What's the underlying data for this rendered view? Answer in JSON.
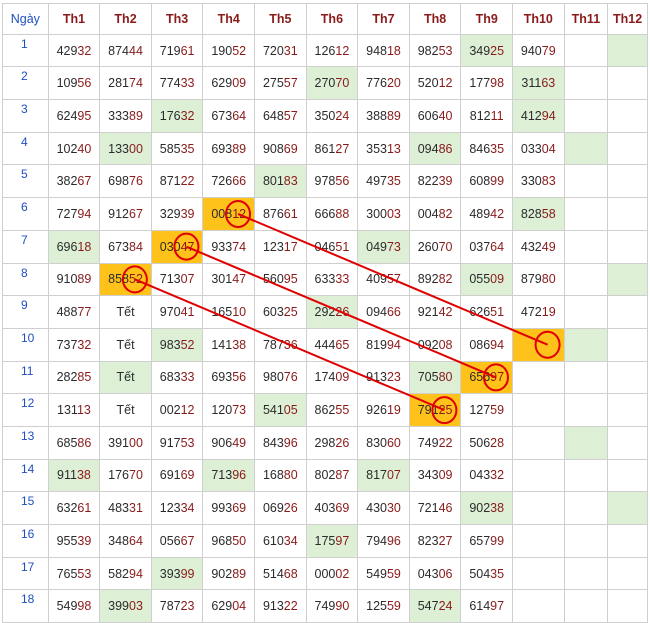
{
  "header": {
    "day_label": "Ngày",
    "months": [
      "Th1",
      "Th2",
      "Th3",
      "Th4",
      "Th5",
      "Th6",
      "Th7",
      "Th8",
      "Th9",
      "Th10",
      "Th11",
      "Th12"
    ]
  },
  "rows": [
    {
      "day": "1",
      "cells": [
        "42932",
        "87444",
        "71961",
        "19052",
        "72031",
        "12612",
        "94818",
        "98253",
        "34925",
        "94079",
        "",
        ""
      ]
    },
    {
      "day": "2",
      "cells": [
        "10956",
        "28174",
        "77433",
        "62909",
        "27557",
        "27070",
        "77620",
        "52012",
        "17798",
        "31163",
        "",
        ""
      ]
    },
    {
      "day": "3",
      "cells": [
        "62495",
        "33389",
        "17632",
        "67364",
        "64857",
        "35024",
        "38889",
        "60640",
        "81211",
        "41294",
        "",
        ""
      ]
    },
    {
      "day": "4",
      "cells": [
        "10240",
        "13300",
        "58535",
        "69389",
        "90869",
        "86127",
        "35313",
        "09486",
        "84635",
        "03304",
        "",
        ""
      ]
    },
    {
      "day": "5",
      "cells": [
        "38267",
        "69876",
        "87122",
        "72666",
        "80183",
        "97856",
        "49735",
        "82239",
        "60899",
        "33083",
        "",
        ""
      ]
    },
    {
      "day": "6",
      "cells": [
        "72794",
        "91267",
        "32939",
        "00812",
        "87661",
        "66688",
        "30003",
        "00482",
        "48942",
        "82858",
        "",
        ""
      ]
    },
    {
      "day": "7",
      "cells": [
        "69618",
        "67384",
        "03047",
        "93374",
        "12317",
        "04651",
        "04973",
        "26070",
        "03764",
        "43249",
        "",
        ""
      ]
    },
    {
      "day": "8",
      "cells": [
        "91089",
        "85852",
        "71307",
        "30147",
        "56095",
        "63333",
        "40957",
        "89282",
        "05509",
        "87980",
        "",
        ""
      ]
    },
    {
      "day": "9",
      "cells": [
        "48877",
        "Tết",
        "97041",
        "16510",
        "60325",
        "29226",
        "09466",
        "92142",
        "62651",
        "47219",
        "",
        ""
      ]
    },
    {
      "day": "10",
      "cells": [
        "73732",
        "Tết",
        "98352",
        "14138",
        "78736",
        "44465",
        "81994",
        "09208",
        "08694",
        "",
        "",
        ""
      ]
    },
    {
      "day": "11",
      "cells": [
        "28285",
        "Tết",
        "68333",
        "69356",
        "98076",
        "17409",
        "91323",
        "70580",
        "65697",
        "",
        "",
        ""
      ]
    },
    {
      "day": "12",
      "cells": [
        "13113",
        "Tết",
        "00212",
        "12073",
        "54105",
        "86255",
        "92619",
        "79125",
        "12759",
        "",
        "",
        ""
      ]
    },
    {
      "day": "13",
      "cells": [
        "68586",
        "39100",
        "91753",
        "90649",
        "84396",
        "29826",
        "83060",
        "74922",
        "50628",
        "",
        "",
        ""
      ]
    },
    {
      "day": "14",
      "cells": [
        "91138",
        "17670",
        "69169",
        "71396",
        "16880",
        "80287",
        "81707",
        "34309",
        "04332",
        "",
        "",
        ""
      ]
    },
    {
      "day": "15",
      "cells": [
        "63261",
        "48331",
        "12334",
        "99369",
        "06926",
        "40369",
        "43030",
        "72146",
        "90238",
        "",
        "",
        ""
      ]
    },
    {
      "day": "16",
      "cells": [
        "95539",
        "34864",
        "05667",
        "96850",
        "61034",
        "17597",
        "79496",
        "82327",
        "65799",
        "",
        "",
        ""
      ]
    },
    {
      "day": "17",
      "cells": [
        "76553",
        "58294",
        "39399",
        "90289",
        "51468",
        "00002",
        "54959",
        "04306",
        "50435",
        "",
        "",
        ""
      ]
    },
    {
      "day": "18",
      "cells": [
        "54998",
        "39903",
        "78723",
        "62904",
        "91322",
        "74990",
        "12559",
        "54724",
        "61497",
        "",
        "",
        ""
      ]
    }
  ],
  "green_cells": [
    [
      0,
      8
    ],
    [
      0,
      11
    ],
    [
      1,
      5
    ],
    [
      1,
      9
    ],
    [
      2,
      2
    ],
    [
      2,
      9
    ],
    [
      3,
      1
    ],
    [
      3,
      7
    ],
    [
      3,
      10
    ],
    [
      4,
      4
    ],
    [
      5,
      9
    ],
    [
      6,
      0
    ],
    [
      6,
      6
    ],
    [
      7,
      1
    ],
    [
      7,
      8
    ],
    [
      7,
      11
    ],
    [
      8,
      5
    ],
    [
      9,
      2
    ],
    [
      9,
      10
    ],
    [
      10,
      1
    ],
    [
      10,
      7
    ],
    [
      11,
      4
    ],
    [
      12,
      10
    ],
    [
      13,
      0
    ],
    [
      13,
      3
    ],
    [
      13,
      6
    ],
    [
      14,
      8
    ],
    [
      14,
      11
    ],
    [
      15,
      5
    ],
    [
      16,
      2
    ],
    [
      17,
      1
    ],
    [
      17,
      7
    ]
  ],
  "orange_cells": [
    [
      5,
      3
    ],
    [
      6,
      2
    ],
    [
      7,
      1
    ],
    [
      9,
      9
    ],
    [
      10,
      8
    ],
    [
      11,
      7
    ]
  ],
  "circled_cells": [
    [
      5,
      3
    ],
    [
      6,
      2
    ],
    [
      7,
      1
    ],
    [
      9,
      9
    ],
    [
      10,
      8
    ],
    [
      11,
      7
    ]
  ],
  "arrows": [
    {
      "from": [
        5,
        3
      ],
      "to": [
        9,
        9
      ]
    },
    {
      "from": [
        6,
        2
      ],
      "to": [
        10,
        8
      ]
    },
    {
      "from": [
        7,
        1
      ],
      "to": [
        11,
        7
      ]
    }
  ],
  "colors": {
    "header_month": "#8b1a1a",
    "day": "#1f4fc0",
    "green": "#ddf0d6",
    "orange": "#ffc21a",
    "arrow": "#e00000",
    "circle": "#e00000"
  }
}
